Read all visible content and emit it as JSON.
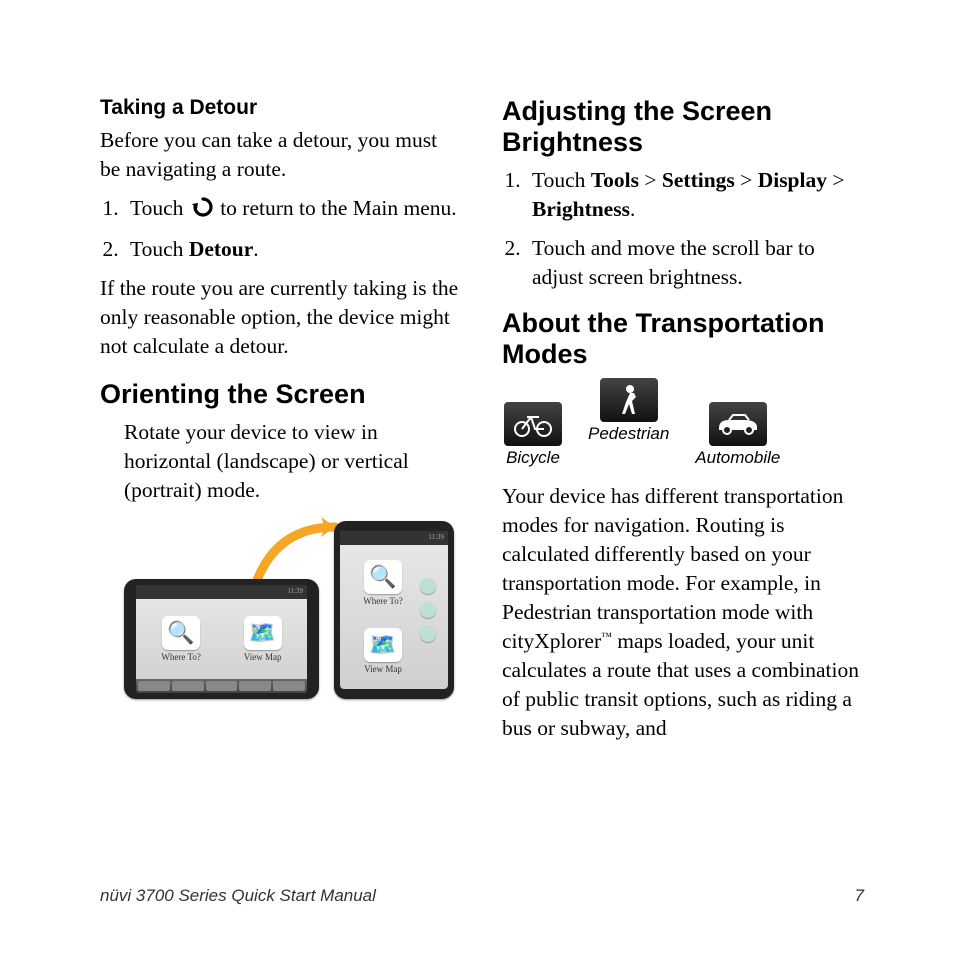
{
  "left": {
    "detour_heading": "Taking a Detour",
    "detour_intro": "Before you can take a detour, you must be navigating a route.",
    "step1_a": "Touch ",
    "step1_b": " to return to the Main menu.",
    "step2_pre": "Touch ",
    "step2_bold": "Detour",
    "step2_post": ".",
    "detour_note": "If the route you are currently taking is the only reasonable option, the device might not calculate a detour.",
    "orient_heading": "Orienting the Screen",
    "orient_body": "Rotate your device to view in horizontal (landscape) or vertical (portrait) mode.",
    "where_to": "Where To?",
    "view_map": "View Map"
  },
  "right": {
    "brightness_heading": "Adjusting the Screen Brightness",
    "b_step1_a": "Touch ",
    "b_step1_tools": "Tools",
    "b_step1_sep1": " > ",
    "b_step1_settings": "Settings",
    "b_step1_sep2": " > ",
    "b_step1_display": "Display",
    "b_step1_sep3": " > ",
    "b_step1_brightness": "Brightness",
    "b_step1_end": ".",
    "b_step2": "Touch and move the scroll bar to adjust screen brightness.",
    "modes_heading": "About the Transportation Modes",
    "mode_bicycle": "Bicycle",
    "mode_pedestrian": "Pedestrian",
    "mode_automobile": "Automobile",
    "modes_body_a": "Your device has different transportation modes for navigation. Routing is calculated differently based on your transportation mode. For example, in Pedestrian transportation mode with cityXplorer",
    "modes_body_tm": "™",
    "modes_body_b": " maps loaded, your unit calculates a route that uses a combination of public transit options, such as riding a bus or subway, and"
  },
  "footer": {
    "title": "nüvi 3700 Series Quick Start Manual",
    "page": "7"
  }
}
